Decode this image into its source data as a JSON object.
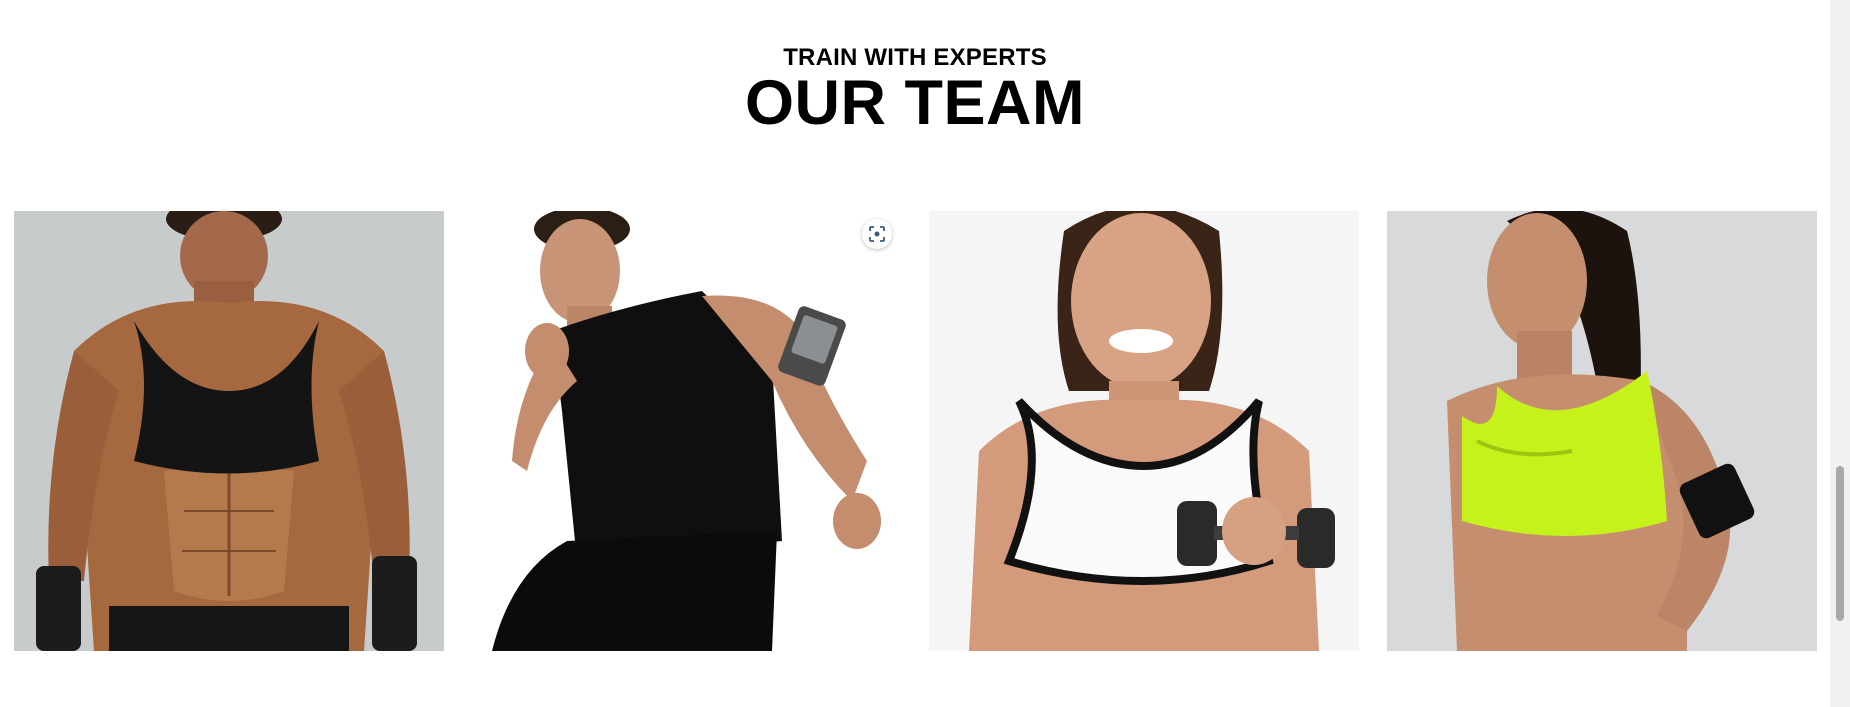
{
  "section": {
    "eyebrow": "TRAIN WITH EXPERTS",
    "title": "OUR TEAM"
  },
  "team_photos": [
    {
      "subject": "woman in black sports bra with hand wraps"
    },
    {
      "subject": "man in black tank top running with armband"
    },
    {
      "subject": "woman in white sports bra holding dumbbell"
    },
    {
      "subject": "woman in neon yellow sports bra smiling"
    }
  ],
  "overlay": {
    "icon": "lens-search-icon"
  },
  "colors": {
    "text": "#000000",
    "background": "#ffffff",
    "neon": "#c6f21c"
  }
}
